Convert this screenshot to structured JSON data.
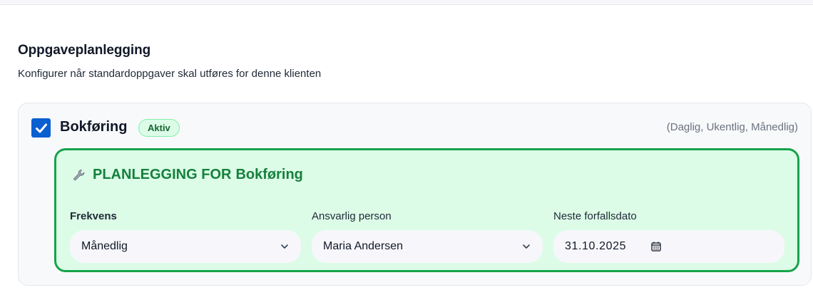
{
  "section": {
    "title": "Oppgaveplanlegging",
    "description": "Konfigurer når standardoppgaver skal utføres for denne klienten"
  },
  "task": {
    "name": "Bokføring",
    "checked": true,
    "status_badge": "Aktiv",
    "frequencies_hint": "(Daglig, Ukentlig, Månedlig)"
  },
  "planning": {
    "title_prefix": "PLANLEGGING FOR",
    "title_task": "Bokføring",
    "icon": "wrench-icon",
    "fields": {
      "frequency": {
        "label": "Frekvens",
        "value": "Månedlig"
      },
      "responsible": {
        "label": "Ansvarlig person",
        "value": "Maria Andersen"
      },
      "due_date": {
        "label": "Neste forfallsdato",
        "value": "31.10.2025"
      }
    }
  },
  "colors": {
    "checkbox": "#0a5fd1",
    "panel_bg": "#dcfce7",
    "panel_border": "#16a34a",
    "panel_title": "#15803d"
  }
}
